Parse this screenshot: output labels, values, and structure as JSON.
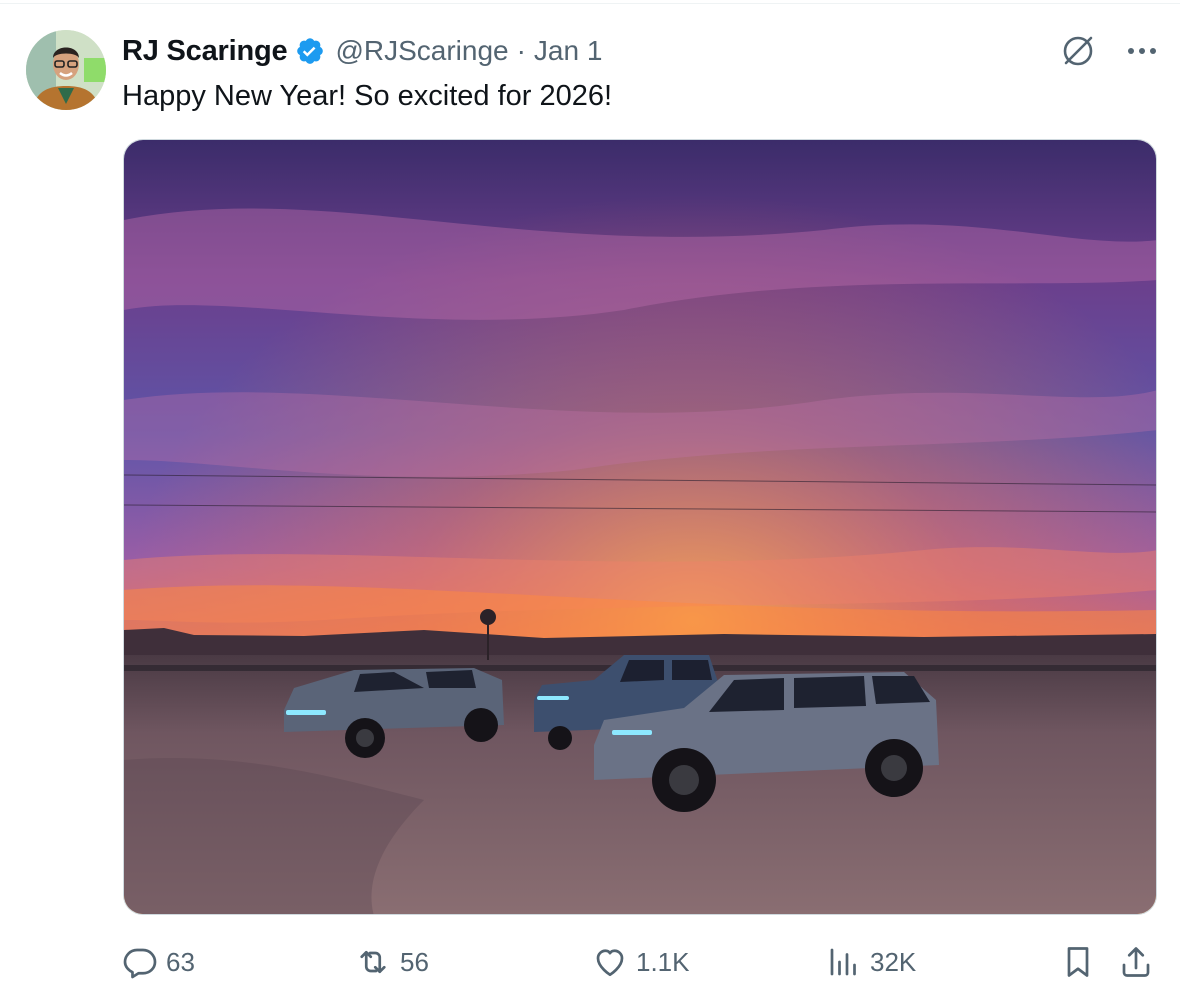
{
  "tweet": {
    "author": {
      "display_name": "RJ Scaringe",
      "handle": "@RJScaringe",
      "verified_icon": "verified-badge-icon"
    },
    "separator": "·",
    "date": "Jan 1",
    "text": "Happy New Year! So excited for 2026!",
    "header_icons": [
      "grok-icon",
      "more-icon"
    ],
    "media": {
      "type": "photo"
    },
    "actions": {
      "replies": "63",
      "reposts": "56",
      "likes": "1.1K",
      "views": "32K"
    }
  },
  "colors": {
    "text_primary": "#0f1419",
    "text_secondary": "#536471",
    "verified": "#1d9bf0",
    "border": "#cfd9de"
  }
}
